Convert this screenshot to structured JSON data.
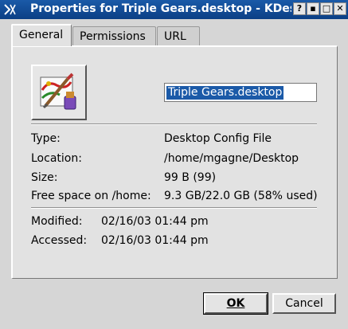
{
  "window": {
    "title": "Properties for Triple Gears.desktop - KDeskto",
    "buttons": {
      "help": "?",
      "minimize": "▪",
      "maximize": "□",
      "close": "✕"
    }
  },
  "tabs": [
    {
      "label": "General",
      "active": true
    },
    {
      "label": "Permissions",
      "active": false
    },
    {
      "label": "URL",
      "active": false
    }
  ],
  "general": {
    "icon": "paint-palette-icon",
    "name_value": "Triple Gears.desktop",
    "type_label": "Type:",
    "type_value": "Desktop Config File",
    "location_label": "Location:",
    "location_value": "/home/mgagne/Desktop",
    "size_label": "Size:",
    "size_value": "99 B (99)",
    "free_label": "Free space on /home:",
    "free_value": "9.3 GB/22.0 GB (58% used)",
    "modified_label": "Modified:",
    "modified_value": "02/16/03 01:44 pm",
    "accessed_label": "Accessed:",
    "accessed_value": "02/16/03 01:44 pm"
  },
  "footer": {
    "ok_label": "OK",
    "cancel_label": "Cancel"
  },
  "colors": {
    "titlebar": "#0b3f85",
    "selection": "#1b5aa8",
    "window_bg": "#d6d6d6"
  }
}
